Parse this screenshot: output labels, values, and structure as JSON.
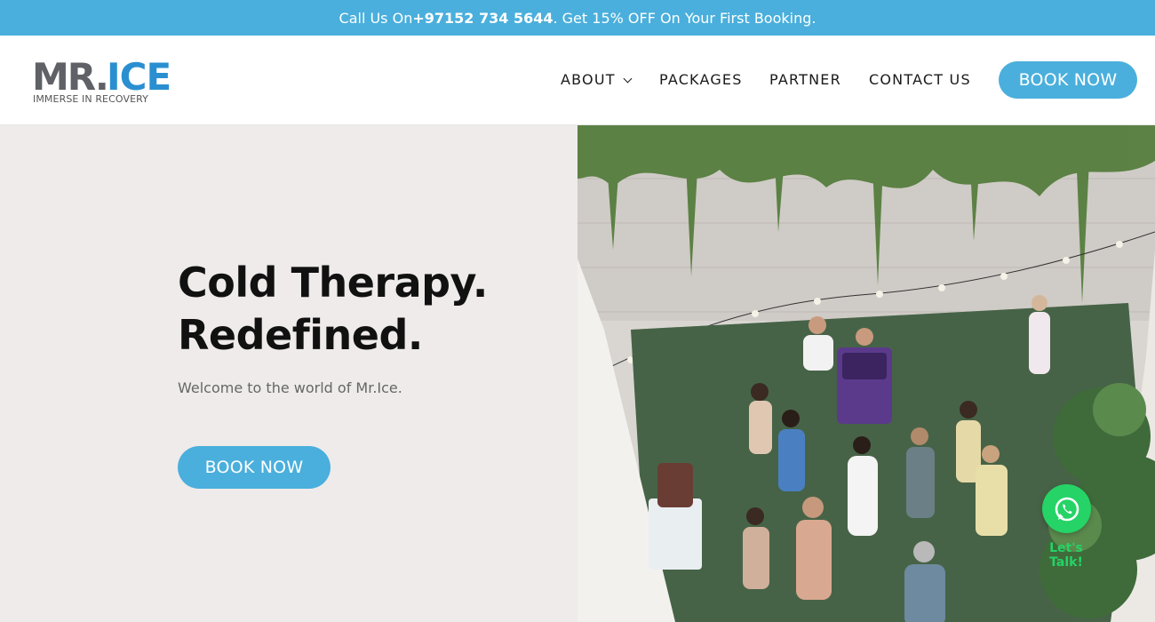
{
  "topbar": {
    "prefix": "Call Us On ",
    "phone": "+97152 734 5644",
    "suffix": ". Get 15% OFF On Your First Booking."
  },
  "logo": {
    "mark_left": "MR.",
    "mark_right": "ICE",
    "tagline": "IMMERSE IN RECOVERY"
  },
  "nav": {
    "items": [
      {
        "label": "ABOUT",
        "has_dropdown": true
      },
      {
        "label": "PACKAGES"
      },
      {
        "label": "PARTNER"
      },
      {
        "label": "CONTACT US"
      }
    ],
    "cta_label": "BOOK NOW"
  },
  "hero": {
    "title_line1": "Cold Therapy.",
    "title_line2": "Redefined.",
    "subtitle": "Welcome to the world of Mr.Ice.",
    "cta_label": "BOOK NOW"
  },
  "whatsapp": {
    "label": "Let's Talk!"
  },
  "colors": {
    "accent": "#4aafdc",
    "logo_blue": "#2a8fd0",
    "logo_gray": "#5f6166",
    "whatsapp_green": "#25d366",
    "hero_bg": "#efebeb"
  }
}
